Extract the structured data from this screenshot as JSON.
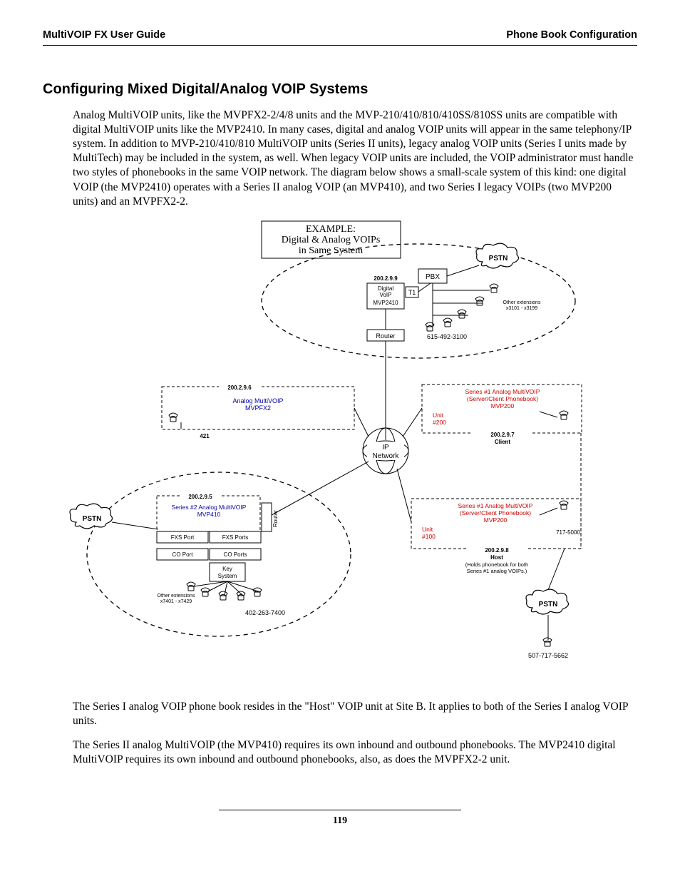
{
  "header": {
    "left": "MultiVOIP FX User Guide",
    "right": "Phone Book Configuration"
  },
  "heading": "Configuring Mixed Digital/Analog VOIP Systems",
  "para1": "Analog MultiVOIP units, like the MVPFX2-2/4/8 units and the MVP-210/410/810/410SS/810SS units are compatible with digital MultiVOIP units like the MVP2410.  In many cases, digital and analog VOIP units will appear in the same telephony/IP system.  In addition to MVP-210/410/810 MultiVOIP units (Series II units), legacy analog VOIP units (Series I units made by MultiTech) may be included in the system, as well.  When legacy VOIP units are included, the VOIP administrator must handle two styles of phonebooks in the same VOIP network.   The diagram below shows a small-scale system of this kind:  one digital VOIP (the MVP2410) operates with a Series II  analog VOIP (an MVP410), and two Series I legacy VOIPs (two MVP200 units) and an MVPFX2-2.",
  "para2": "The Series I analog VOIP phone book resides in the \"Host\" VOIP unit at Site B.  It applies to both of the Series I analog VOIP units.",
  "para3": "The Series II analog MultiVOIP (the MVP410) requires its own inbound and outbound phonebooks.  The MVP2410 digital MultiVOIP requires its own inbound and outbound phonebooks, also, as does the MVPFX2-2 unit.",
  "page_number": "119",
  "diagram": {
    "title1": "EXAMPLE:",
    "title2": "Digital & Analog VOIPs",
    "title3": "in Same System",
    "top": {
      "pstn": "PSTN",
      "pbx": "PBX",
      "ip": "200.2.9.9",
      "dev1": "Digital",
      "dev2": "VoIP",
      "dev3": "MVP2410",
      "t1": "T1",
      "router": "Router",
      "num": "615-492-3100",
      "ext1": "Other extensions",
      "ext2": "x3101 - x3199"
    },
    "ipnet1": "IP",
    "ipnet2": "Network",
    "mid_left": {
      "ip": "200.2.9.6",
      "l1": "Analog MultiVOIP",
      "l2": "MVPFX2",
      "ext": "421"
    },
    "mid_right": {
      "l1": "Series #1 Analog MultiVOIP",
      "l2": "(Server/Client Phonebook)",
      "l3": "MVP200",
      "u1": "Unit",
      "u2": "#200",
      "ip": "200.2.9.7",
      "role": "Client"
    },
    "bot_left": {
      "pstn": "PSTN",
      "ip": "200.2.9.5",
      "l1": "Series #2 Analog MultiVOIP",
      "l2": "MVP410",
      "router": "Router",
      "fxs1": "FXS Port",
      "fxs2": "FXS Ports",
      "co1": "CO Port",
      "co2": "CO Ports",
      "key1": "Key",
      "key2": "System",
      "ext1": "Other extensions",
      "ext2": "x7401 - x7429",
      "num": "402-263-7400"
    },
    "bot_right": {
      "l1": "Series #1 Analog MultiVOIP",
      "l2": "(Server/Client Phonebook)",
      "l3": "MVP200",
      "u1": "Unit",
      "u2": "#100",
      "ip": "200.2.9.8",
      "role": "Host",
      "note1": "(Holds phonebook for both",
      "note2": "Series #1 analog VOIPs.)",
      "num1": "717-5000",
      "pstn": "PSTN",
      "num2": "507-717-5662"
    }
  }
}
